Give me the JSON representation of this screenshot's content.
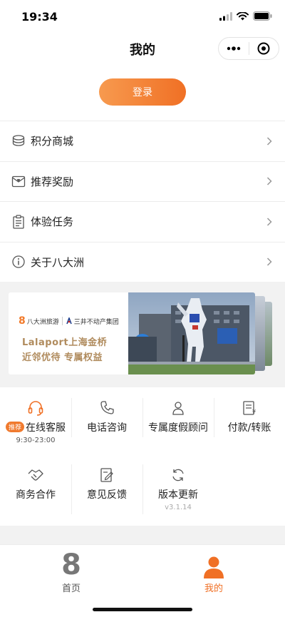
{
  "status_bar": {
    "time": "19:34"
  },
  "nav": {
    "title": "我的"
  },
  "login": {
    "label": "登录"
  },
  "menu": [
    {
      "label": "积分商城",
      "icon": "coins-stack-icon"
    },
    {
      "label": "推荐奖励",
      "icon": "gift-envelope-icon"
    },
    {
      "label": "体验任务",
      "icon": "clipboard-task-icon"
    },
    {
      "label": "关于八大洲",
      "icon": "info-icon"
    }
  ],
  "banner": {
    "brand1": "八大洲旅游",
    "brand2": "三井不动产集团",
    "line1": "Lalaport上海金桥",
    "line2": "近邻优待  专属权益"
  },
  "services": {
    "online_service": {
      "badge": "推荐",
      "label": "在线客服",
      "hours": "9:30-23:00"
    },
    "phone": {
      "label": "电话咨询"
    },
    "advisor": {
      "label": "专属度假顾问"
    },
    "payment": {
      "label": "付款/转账"
    },
    "business": {
      "label": "商务合作"
    },
    "feedback": {
      "label": "意见反馈"
    },
    "update": {
      "label": "版本更新",
      "version": "v3.1.14"
    }
  },
  "tabbar": {
    "home": {
      "label": "首页",
      "logo": "8"
    },
    "mine": {
      "label": "我的"
    }
  },
  "colors": {
    "accent": "#f07025",
    "accent_light": "#f79a4f",
    "banner_text": "#b08b5d"
  }
}
